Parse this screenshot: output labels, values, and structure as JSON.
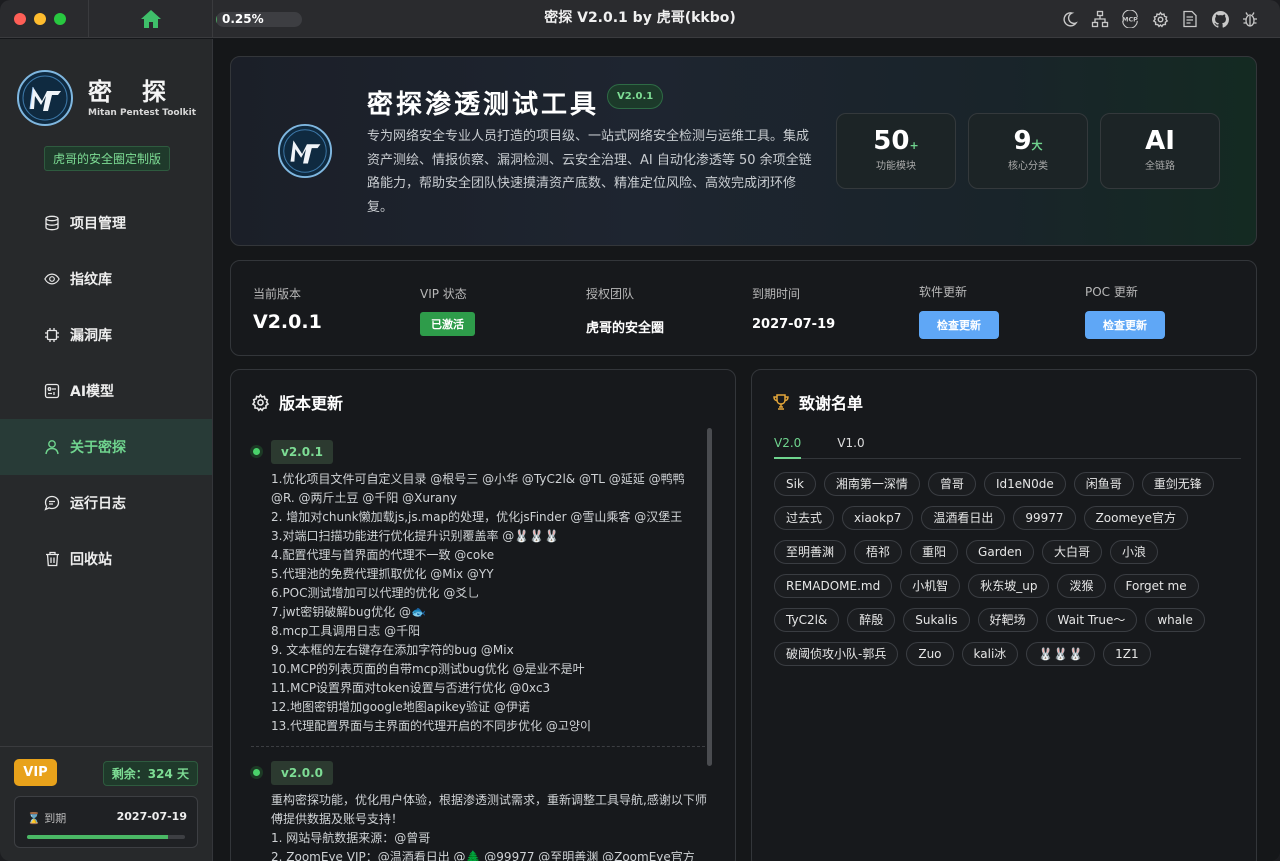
{
  "window": {
    "title": "密探 V2.0.1 by 虎哥(kkbo)",
    "progress_text": "0.25%",
    "progress_value": 0.0025,
    "traffic_lights": [
      "#fe5f57",
      "#febc2e",
      "#28c840"
    ],
    "toolbar_icons": [
      "moon-icon",
      "network-icon",
      "mcp-icon",
      "gear-icon",
      "document-icon",
      "github-icon",
      "bug-icon"
    ],
    "mcp_label": "MCP"
  },
  "sidebar": {
    "brand_cn": "密探",
    "brand_en": "Mitan Pentest Toolkit",
    "custom_badge": "虎哥的安全圈定制版",
    "items": [
      {
        "label": "项目管理",
        "icon": "database-icon",
        "active": false
      },
      {
        "label": "指纹库",
        "icon": "eye-icon",
        "active": false
      },
      {
        "label": "漏洞库",
        "icon": "chip-icon",
        "active": false
      },
      {
        "label": "AI模型",
        "icon": "ai-icon",
        "active": false
      },
      {
        "label": "关于密探",
        "icon": "user-icon",
        "active": true
      },
      {
        "label": "运行日志",
        "icon": "chat-icon",
        "active": false
      },
      {
        "label": "回收站",
        "icon": "trash-icon",
        "active": false
      }
    ],
    "vip_label": "VIP",
    "remaining": "剩余：324 天",
    "expire_label": "⌛ 到期",
    "expire_date": "2027-07-19",
    "remaining_fraction": 0.89
  },
  "hero": {
    "title": "密探渗透测试工具",
    "version_badge": "V2.0.1",
    "description": "专为网络安全专业人员打造的项目级、一站式网络安全检测与运维工具。集成资产测绘、情报侦察、漏洞检测、云安全治理、AI 自动化渗透等 50 余项全链路能力，帮助安全团队快速摸清资产底数、精准定位风险、高效完成闭环修复。",
    "stats": [
      {
        "num": "50",
        "sup": "+",
        "label": "功能模块"
      },
      {
        "num": "9",
        "sup": "大",
        "label": "核心分类"
      },
      {
        "num": "AI",
        "sup": "",
        "label": "全链路"
      }
    ]
  },
  "info": {
    "current_version_label": "当前版本",
    "current_version": "V2.0.1",
    "vip_status_label": "VIP 状态",
    "vip_status": "已激活",
    "team_label": "授权团队",
    "team": "虎哥的安全圈",
    "expire_label": "到期时间",
    "expire": "2027-07-19",
    "software_update_label": "软件更新",
    "poc_update_label": "POC 更新",
    "check_update": "检查更新"
  },
  "changelog": {
    "title": "版本更新",
    "versions": [
      {
        "version": "v2.0.1",
        "lines": [
          "1.优化项目文件可自定义目录 @根号三 @小华 @TyC2l& @TL @延延 @鸭鸭 @R. @两斤土豆 @千阳 @Xurany",
          "2. 增加对chunk懒加载js,js.map的处理，优化jsFinder @雪山乘客 @汉堡王",
          "3.对端口扫描功能进行优化提升识别覆盖率 @🐰🐰🐰",
          "4.配置代理与首界面的代理不一致 @coke",
          "5.代理池的免费代理抓取优化 @Mix @YY",
          "6.POC测试增加可以代理的优化 @爻乚",
          "7.jwt密钥破解bug优化 @🐟",
          "8.mcp工具调用日志 @千阳",
          "9. 文本框的左右键存在添加字符的bug @Mix",
          "10.MCP的列表页面的自带mcp测试bug优化 @是业不是叶",
          "11.MCP设置界面对token设置与否进行优化 @0xc3",
          "12.地图密钥增加google地图apikey验证 @伊诺",
          "13.代理配置界面与主界面的代理开启的不同步优化 @고양이"
        ]
      },
      {
        "version": "v2.0.0",
        "lines": [
          "重构密探功能，优化用户体验，根据渗透测试需求，重新调整工具导航,感谢以下师傅提供数据及账号支持！",
          "1. 网站导航数据来源：@曾哥",
          "2. ZoomEye VIP：@温酒看日出 @🌲 @99977 @至明善渊 @ZoomEye官方"
        ]
      }
    ]
  },
  "thanks": {
    "title": "致谢名单",
    "tabs": [
      "V2.0",
      "V1.0"
    ],
    "names": [
      "Sik",
      "湘南第一深情",
      "曾哥",
      "Id1eN0de",
      "闲鱼哥",
      "重剑无锋",
      "过去式",
      "xiaokp7",
      "温酒看日出",
      "99977",
      "Zoomeye官方",
      "至明善渊",
      "梧祁",
      "重阳",
      "Garden",
      "大白哥",
      "小浪",
      "REMADOME.md",
      "小机智",
      "秋东坡_up",
      "泼猴",
      "Forget me",
      "TyC2l&",
      "醉殷",
      "Sukalis",
      "好靶场",
      "Wait True～",
      "whale",
      "破阈侦攻小队-郭兵",
      "Zuo",
      "kali冰",
      "🐰🐰🐰",
      "1Z1"
    ]
  }
}
